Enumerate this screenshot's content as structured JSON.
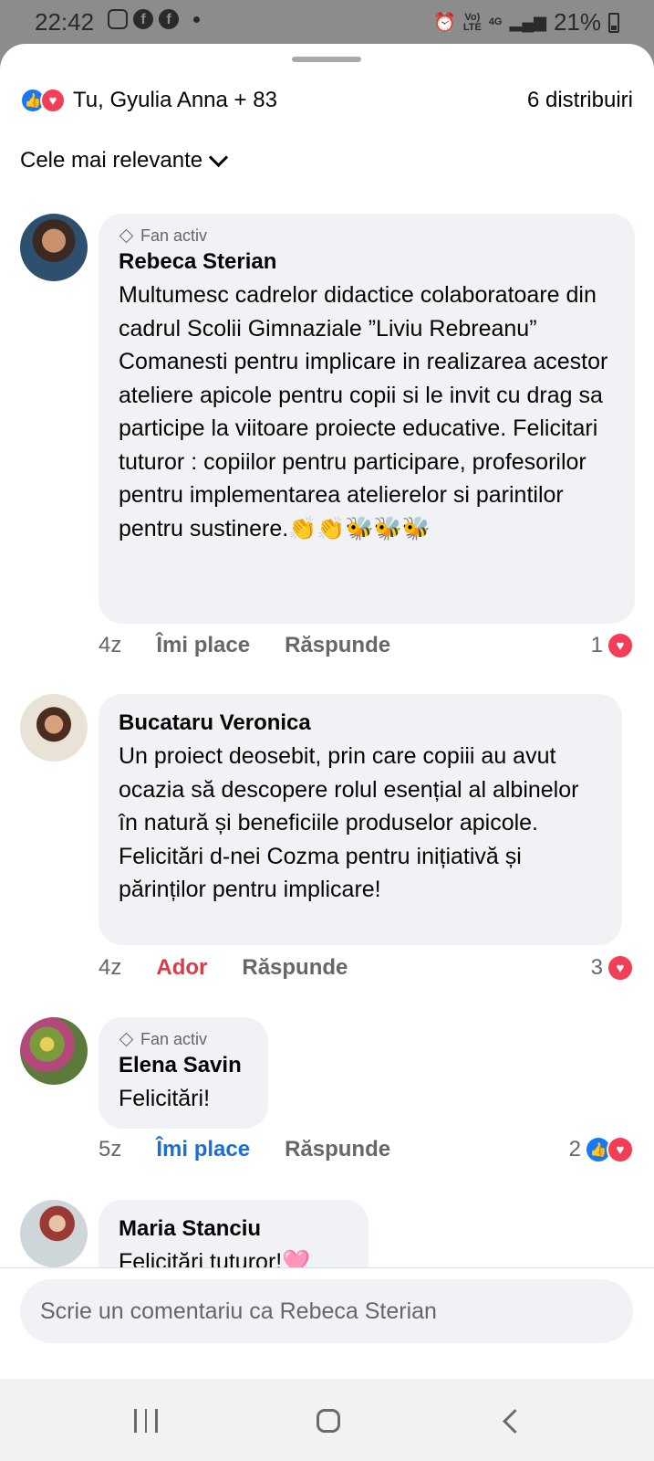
{
  "status_bar": {
    "time": "22:42",
    "network_top": "Vo)",
    "network_bottom": "LTE",
    "net_type": "4G",
    "battery": "21%"
  },
  "header": {
    "reactions": {
      "like_icon": "like-icon",
      "love_icon": "love-icon",
      "summary": "Tu, Gyulia Anna + 83"
    },
    "shares": "6 distribuiri"
  },
  "sort": {
    "label": "Cele mai relevante"
  },
  "colors": {
    "like": "#1877f2",
    "love": "#f33e58",
    "liked_text": "#1a6ed8",
    "loved_text": "#d43d4b",
    "bubble": "#f0f2f5",
    "secondary_text": "#65676b"
  },
  "comments": [
    {
      "badge": "Fan activ",
      "author": "Rebeca Sterian",
      "text": "Multumesc cadrelor didactice colaboratoare din cadrul  Scolii Gimnaziale ”Liviu Rebreanu” Comanesti pentru implicare in realizarea acestor ateliere apicole pentru copii si le invit cu drag sa participe la viitoare proiecte educative. Felicitari tuturor : copiilor pentru participare, profesorilor pentru implementarea atelierelor si parintilor pentru sustinere.👏👏🐝🐝🐝",
      "time": "4z",
      "reaction_label": "Îmi place",
      "reply_label": "Răspunde",
      "reaction_count": "1"
    },
    {
      "badge": "",
      "author": "Bucataru Veronica",
      "text": "Un proiect deosebit, prin care copiii au avut ocazia să descopere rolul esențial al albinelor în natură și beneficiile produselor apicole. Felicitări d-nei Cozma pentru inițiativă și părinților pentru implicare!",
      "time": "4z",
      "reaction_label": "Ador",
      "reply_label": "Răspunde",
      "reaction_count": "3"
    },
    {
      "badge": "Fan activ",
      "author": "Elena Savin",
      "text": "Felicitări!",
      "time": "5z",
      "reaction_label": "Îmi place",
      "reply_label": "Răspunde",
      "reaction_count": "2"
    },
    {
      "badge": "",
      "author": "Maria Stanciu",
      "text": "Felicitări tuturor!🩷"
    }
  ],
  "composer": {
    "placeholder": "Scrie un comentariu ca Rebeca Sterian"
  },
  "nav": {
    "recents_icon": "recents-icon",
    "home_icon": "home-icon",
    "back_icon": "back-icon"
  }
}
